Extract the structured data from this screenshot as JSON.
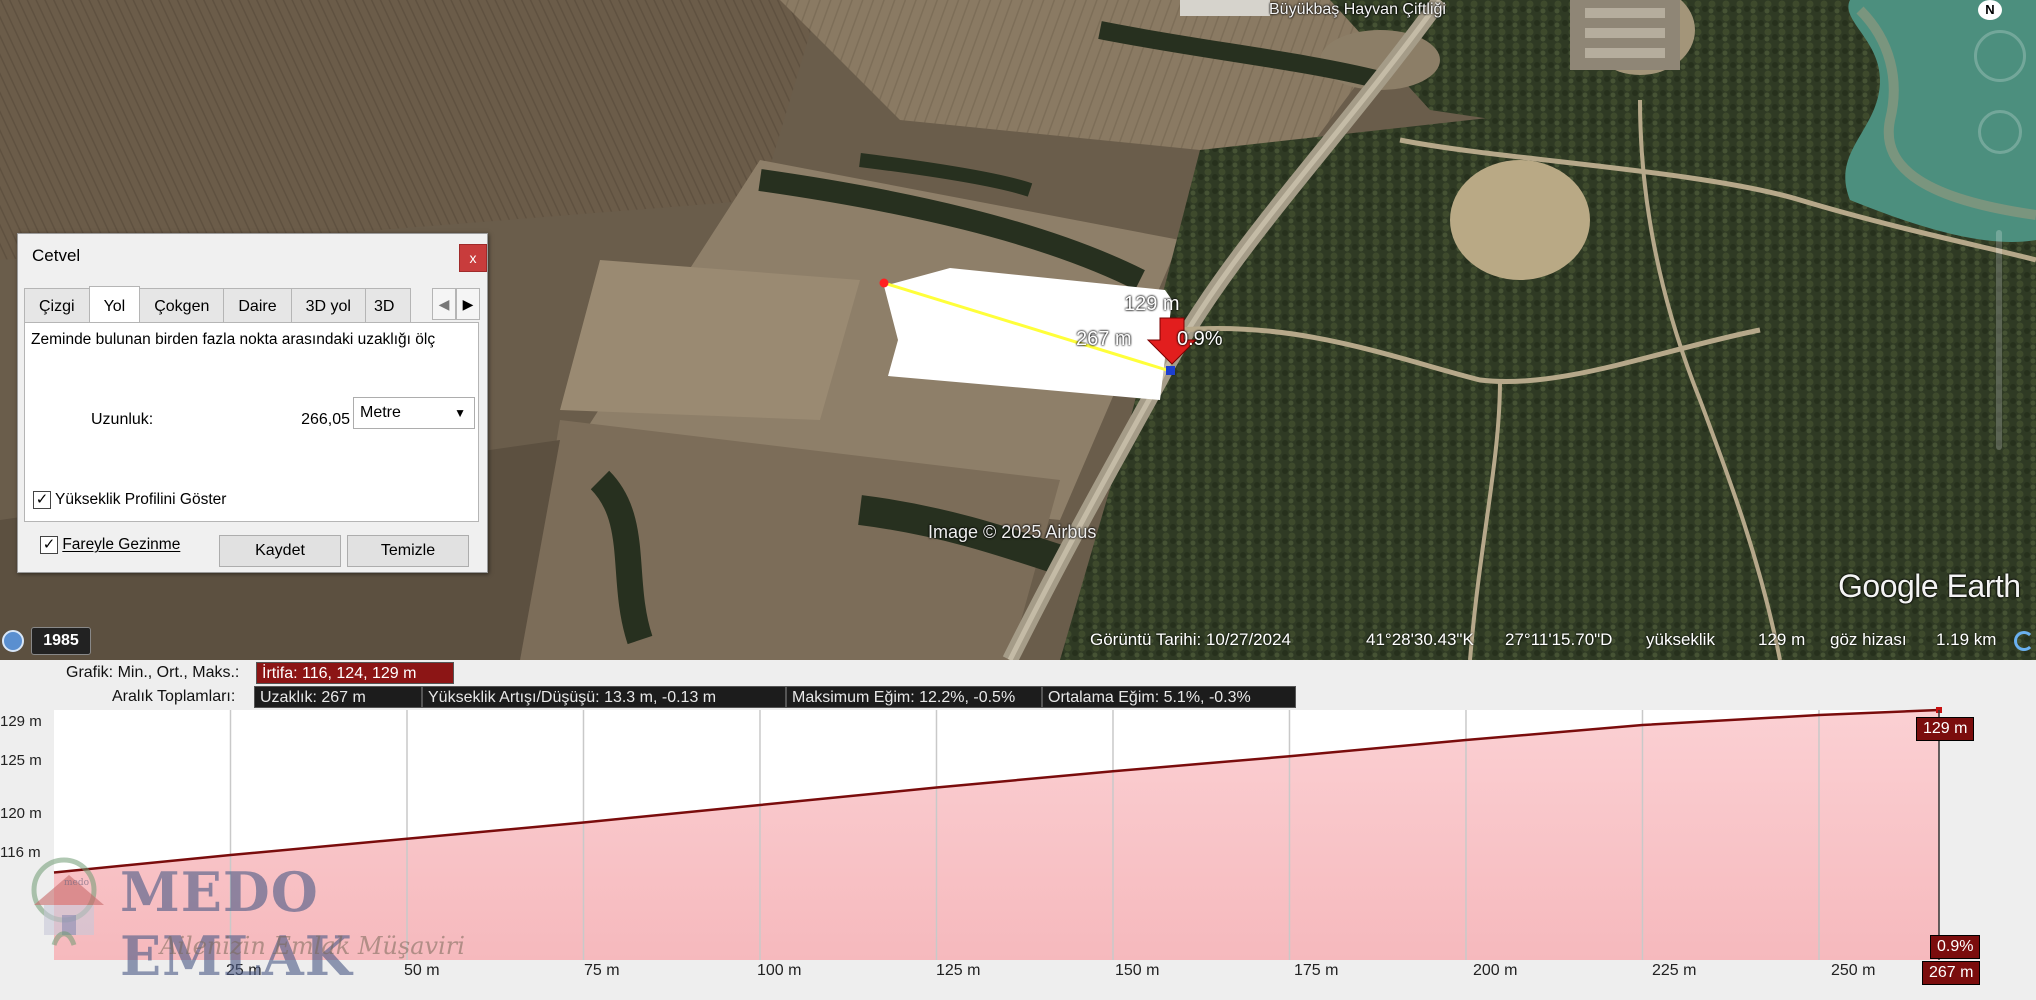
{
  "ruler": {
    "title": "Cetvel",
    "close": "x",
    "tabs": [
      "Çizgi",
      "Yol",
      "Çokgen",
      "Daire",
      "3D yol",
      "3D"
    ],
    "active_tab": "Yol",
    "description": "Zeminde bulunan birden fazla nokta arasındaki uzaklığı ölç",
    "length_label": "Uzunluk:",
    "length_value": "266,05",
    "unit": "Metre",
    "elevation_profile_label": "Yükseklik Profilini Göster",
    "elevation_profile_checked": true,
    "mouse_nav_label": "Fareyle Gezinme",
    "mouse_nav_checked": true,
    "save_label": "Kaydet",
    "clear_label": "Temizle"
  },
  "map": {
    "place_label": "Büyükbaş Hayvan Çiftliği",
    "compass": "N",
    "path_elevation_label": "129 m",
    "path_distance_label": "267 m",
    "path_slope_label": "0.9%",
    "copyright": "Image © 2025 Airbus",
    "brand": "Google Earth",
    "year_button": "1985",
    "status": {
      "imagery_date": "Görüntü Tarihi: 10/27/2024",
      "lat": "41°28'30.43\"K",
      "lon": "27°11'15.70\"D",
      "elevation_label": "yükseklik",
      "elevation_value": "129 m",
      "eye_alt_label": "göz hizası",
      "eye_alt_value": "1.19 km"
    }
  },
  "elevation": {
    "graph_label": "Grafik: Min., Ort., Maks.:",
    "graph_value": "İrtifa: 116, 124, 129 m",
    "range_label": "Aralık Toplamları:",
    "distance": "Uzaklık: 267 m",
    "gain": "Yükseklik Artışı/Düşüşü: 13.3 m, -0.13 m",
    "max_slope": "Maksimum Eğim: 12.2%, -0.5%",
    "avg_slope": "Ortalama Eğim: 5.1%, -0.3%",
    "max_tag": "129 m",
    "slope_tag": "0.9%",
    "end_tag": "267 m"
  },
  "chart_data": {
    "type": "area",
    "xlabel": "",
    "ylabel": "",
    "x_ticks": [
      "25 m",
      "50 m",
      "75 m",
      "100 m",
      "125 m",
      "150 m",
      "175 m",
      "200 m",
      "225 m",
      "250 m"
    ],
    "y_ticks": [
      "129 m",
      "125 m",
      "120 m",
      "116 m"
    ],
    "x": [
      0,
      25,
      50,
      75,
      100,
      125,
      150,
      175,
      200,
      225,
      250,
      267
    ],
    "y": [
      116.0,
      117.4,
      118.7,
      120.0,
      121.4,
      122.8,
      124.1,
      125.3,
      126.6,
      127.8,
      128.6,
      129.0
    ],
    "xlim": [
      0,
      267
    ],
    "ylim": [
      109,
      129
    ],
    "fill_color": "#f6b9bd",
    "line_color": "#7a0c0c",
    "grid": true
  },
  "watermark": {
    "name": "MEDO EMLAK",
    "tagline": "Ailenizin Emlak Müşaviri",
    "small": "medo"
  }
}
